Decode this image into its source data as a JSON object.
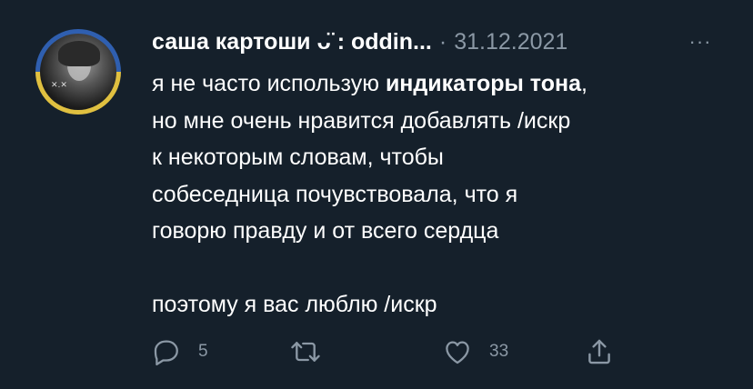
{
  "tweet": {
    "display_name": "саша картоши ᴗ̈ : oddin...",
    "separator": "·",
    "date": "31.12.2021",
    "more_label": "···",
    "text": {
      "line1_before": "я не часто использую ",
      "line1_bold": "индикаторы тона",
      "line1_after": ",",
      "line2": "но мне очень нравится добавлять /искр",
      "line3": "к некоторым словам, чтобы",
      "line4": "собеседница почувствовала, что я",
      "line5": "говорю правду и от всего сердца",
      "line6": "поэтому я вас люблю /искр"
    },
    "avatar_mark": "✕.✕"
  },
  "actions": {
    "reply_count": "5",
    "retweet_count": "",
    "like_count": "33",
    "icons": [
      "reply-icon",
      "retweet-icon",
      "like-icon",
      "share-icon"
    ]
  },
  "colors": {
    "background": "#15202b",
    "text": "#ffffff",
    "muted": "#8b98a5",
    "avatar_ring_top": "#2f5fb0",
    "avatar_ring_bottom": "#e0c040"
  }
}
